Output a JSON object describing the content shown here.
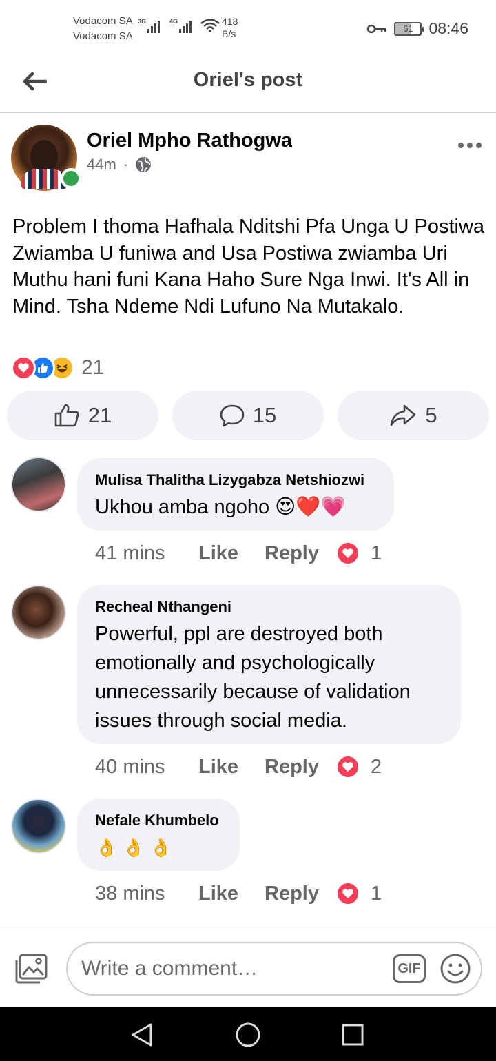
{
  "status_bar": {
    "carrier_1": "Vodacom SA",
    "carrier_2": "Vodacom SA",
    "network_1": "3G",
    "network_2": "4G",
    "speed_value": "418",
    "speed_unit": "B/s",
    "battery": "61",
    "time": "08:46"
  },
  "header": {
    "title": "Oriel's post",
    "back_icon": "arrow-left-icon"
  },
  "post": {
    "author": "Oriel Mpho Rathogwa",
    "time": "44m",
    "separator": "·",
    "privacy_icon": "globe-icon",
    "text": "Problem I thoma Hafhala Nditshi Pfa Unga U Postiwa Zwiamba U funiwa and Usa Postiwa zwiamba Uri Muthu hani funi Kana Haho Sure Nga Inwi. It's All in Mind. Tsha Ndeme Ndi Lufuno Na Mutakalo.",
    "reaction_count": "21",
    "reactions": [
      "love",
      "like",
      "haha"
    ],
    "actions": {
      "like_count": "21",
      "comment_count": "15",
      "share_count": "5"
    }
  },
  "comments": [
    {
      "name": "Mulisa Thalitha Lizygabza Netshiozwi",
      "text": "Ukhou amba ngoho 😍❤️💗",
      "time": "41 mins",
      "like_label": "Like",
      "reply_label": "Reply",
      "reaction_count": "1"
    },
    {
      "name": "Recheal Nthangeni",
      "text": "Powerful, ppl are destroyed both emotionally and psychologically unnecessarily because of validation issues through social media.",
      "time": "40 mins",
      "like_label": "Like",
      "reply_label": "Reply",
      "reaction_count": "2"
    },
    {
      "name": "Nefale Khumbelo",
      "text": "👌 👌 👌",
      "time": "38 mins",
      "like_label": "Like",
      "reply_label": "Reply",
      "reaction_count": "1"
    }
  ],
  "comment_bar": {
    "placeholder": "Write a comment…",
    "gif_label": "GIF"
  },
  "colors": {
    "like_blue": "#1877f2",
    "love_red": "#f33e58",
    "haha_yellow": "#f7b928",
    "online_green": "#31a24c",
    "bubble_gray": "#f0f2f5",
    "meta_gray": "#65676b"
  }
}
